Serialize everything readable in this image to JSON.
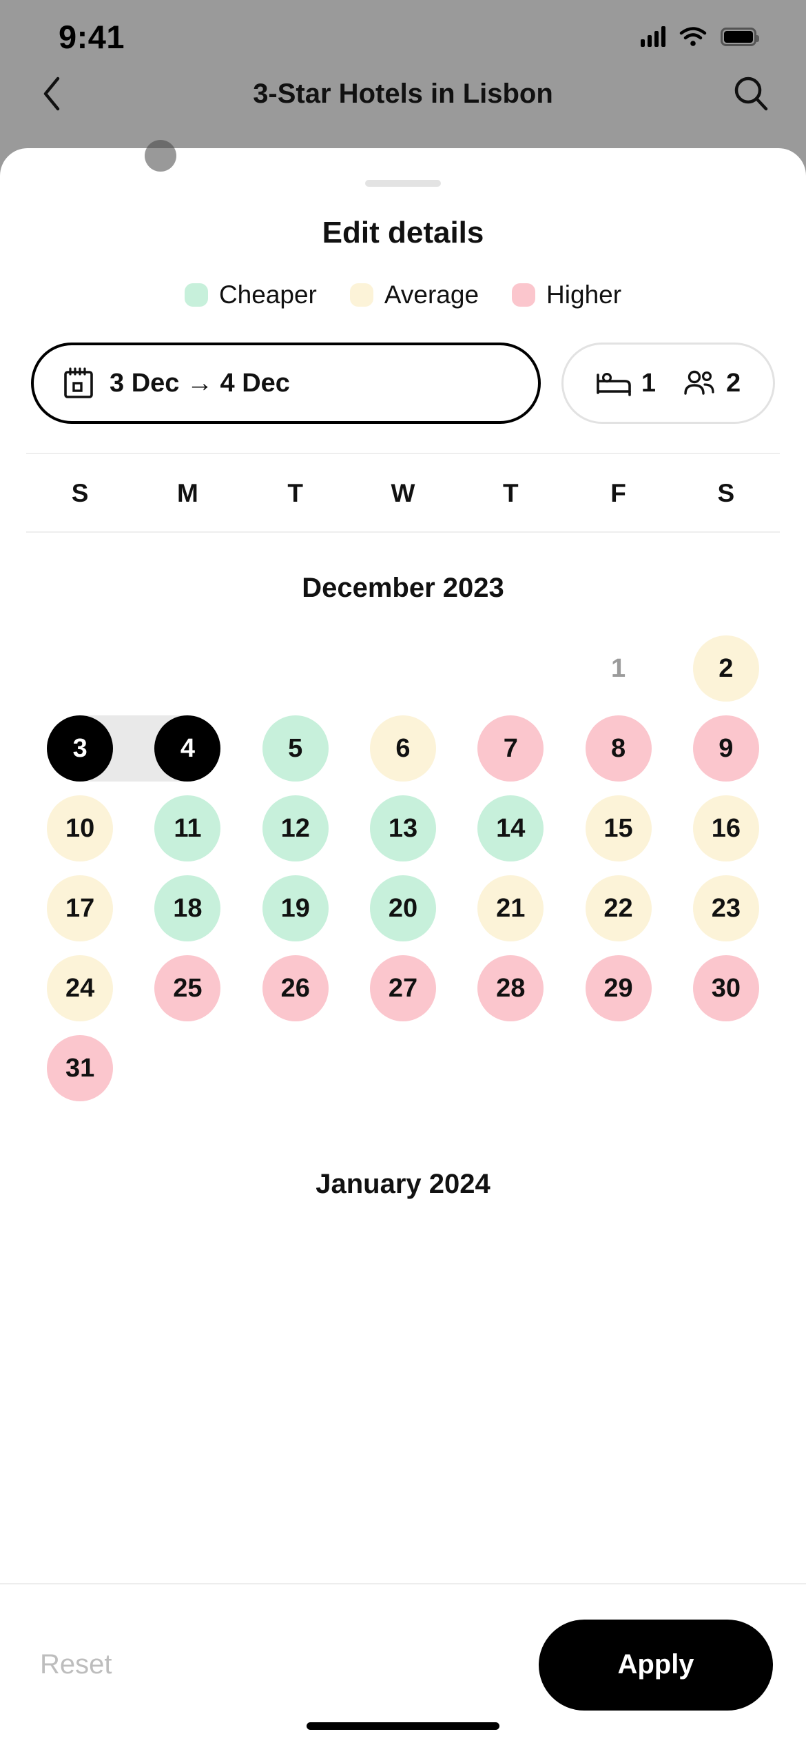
{
  "status_bar": {
    "time": "9:41",
    "icons": [
      "cellular-signal-icon",
      "wifi-icon",
      "battery-icon"
    ]
  },
  "nav_bar": {
    "back_icon": "chevron-left-icon",
    "title": "3-Star Hotels in Lisbon",
    "search_icon": "search-icon"
  },
  "filter_chips": [
    {
      "label": "",
      "selected": true
    },
    {
      "label": "",
      "selected": false
    },
    {
      "label": "",
      "selected": false
    },
    {
      "label": "",
      "selected": false
    }
  ],
  "sheet": {
    "title": "Edit details",
    "legend": [
      {
        "label": "Cheaper",
        "color": "#C7F0DB"
      },
      {
        "label": "Average",
        "color": "#FCF3D8"
      },
      {
        "label": "Higher",
        "color": "#FBC6CD"
      }
    ],
    "date_chip": {
      "icon": "calendar-icon",
      "text": "3 Dec → 4 Dec"
    },
    "guest_chip": {
      "bed_icon": "bed-icon",
      "rooms": "1",
      "guests_icon": "guests-icon",
      "guests": "2"
    },
    "weekdays": [
      "S",
      "M",
      "T",
      "W",
      "T",
      "F",
      "S"
    ],
    "months": [
      {
        "title": "December 2023",
        "lead_blanks": 5,
        "days": [
          {
            "n": "1",
            "tone": "muted"
          },
          {
            "n": "2",
            "tone": "average"
          },
          {
            "n": "3",
            "tone": "selected",
            "range": "start"
          },
          {
            "n": "4",
            "tone": "selected",
            "range": "end"
          },
          {
            "n": "5",
            "tone": "cheaper"
          },
          {
            "n": "6",
            "tone": "average"
          },
          {
            "n": "7",
            "tone": "higher"
          },
          {
            "n": "8",
            "tone": "higher"
          },
          {
            "n": "9",
            "tone": "higher"
          },
          {
            "n": "10",
            "tone": "average"
          },
          {
            "n": "11",
            "tone": "cheaper"
          },
          {
            "n": "12",
            "tone": "cheaper"
          },
          {
            "n": "13",
            "tone": "cheaper"
          },
          {
            "n": "14",
            "tone": "cheaper"
          },
          {
            "n": "15",
            "tone": "average"
          },
          {
            "n": "16",
            "tone": "average"
          },
          {
            "n": "17",
            "tone": "average"
          },
          {
            "n": "18",
            "tone": "cheaper"
          },
          {
            "n": "19",
            "tone": "cheaper"
          },
          {
            "n": "20",
            "tone": "cheaper"
          },
          {
            "n": "21",
            "tone": "average"
          },
          {
            "n": "22",
            "tone": "average"
          },
          {
            "n": "23",
            "tone": "average"
          },
          {
            "n": "24",
            "tone": "average"
          },
          {
            "n": "25",
            "tone": "higher"
          },
          {
            "n": "26",
            "tone": "higher"
          },
          {
            "n": "27",
            "tone": "higher"
          },
          {
            "n": "28",
            "tone": "higher"
          },
          {
            "n": "29",
            "tone": "higher"
          },
          {
            "n": "30",
            "tone": "higher"
          },
          {
            "n": "31",
            "tone": "higher"
          }
        ]
      },
      {
        "title": "January 2024",
        "lead_blanks": 0,
        "days": []
      }
    ]
  },
  "footer": {
    "reset_label": "Reset",
    "apply_label": "Apply"
  }
}
